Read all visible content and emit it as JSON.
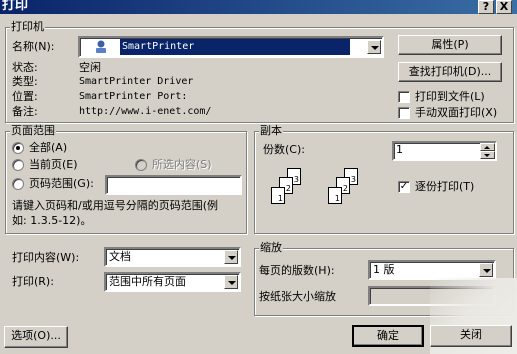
{
  "window": {
    "title": "打印",
    "help_label": "?",
    "close_label": "X"
  },
  "printer": {
    "group_label": "打印机",
    "name_label": "名称(N):",
    "name_value": "SmartPrinter",
    "status_label": "状态:",
    "status_value": "空闲",
    "type_label": "类型:",
    "type_value": "SmartPrinter Driver",
    "where_label": "位置:",
    "where_value": "SmartPrinter Port:",
    "comment_label": "备注:",
    "comment_value": "http://www.i-enet.com/",
    "properties_button": "属性(P)",
    "find_button": "查找打印机(D)...",
    "print_to_file_label": "打印到文件(L)",
    "manual_duplex_label": "手动双面打印(X)"
  },
  "page_range": {
    "group_label": "页面范围",
    "all_label": "全部(A)",
    "current_label": "当前页(E)",
    "selection_label": "所选内容(S)",
    "pages_label": "页码范围(G):",
    "pages_value": "",
    "hint_line1": "请键入页码和/或用逗号分隔的页码范围(例",
    "hint_line2": "如: 1.3.5-12)。"
  },
  "copies": {
    "group_label": "副本",
    "count_label": "份数(C):",
    "count_value": "1",
    "collate_label": "逐份打印(T)",
    "collate_checked": true
  },
  "print_what": {
    "label": "打印内容(W):",
    "value": "文档",
    "print_label": "打印(R):",
    "print_value": "范围中所有页面"
  },
  "zoom": {
    "group_label": "缩放",
    "pages_per_sheet_label": "每页的版数(H):",
    "pages_per_sheet_value": "1 版",
    "scale_label": "按纸张大小缩放"
  },
  "footer": {
    "options_button": "选项(O)...",
    "ok_button": "确定",
    "close_button": "关闭"
  }
}
